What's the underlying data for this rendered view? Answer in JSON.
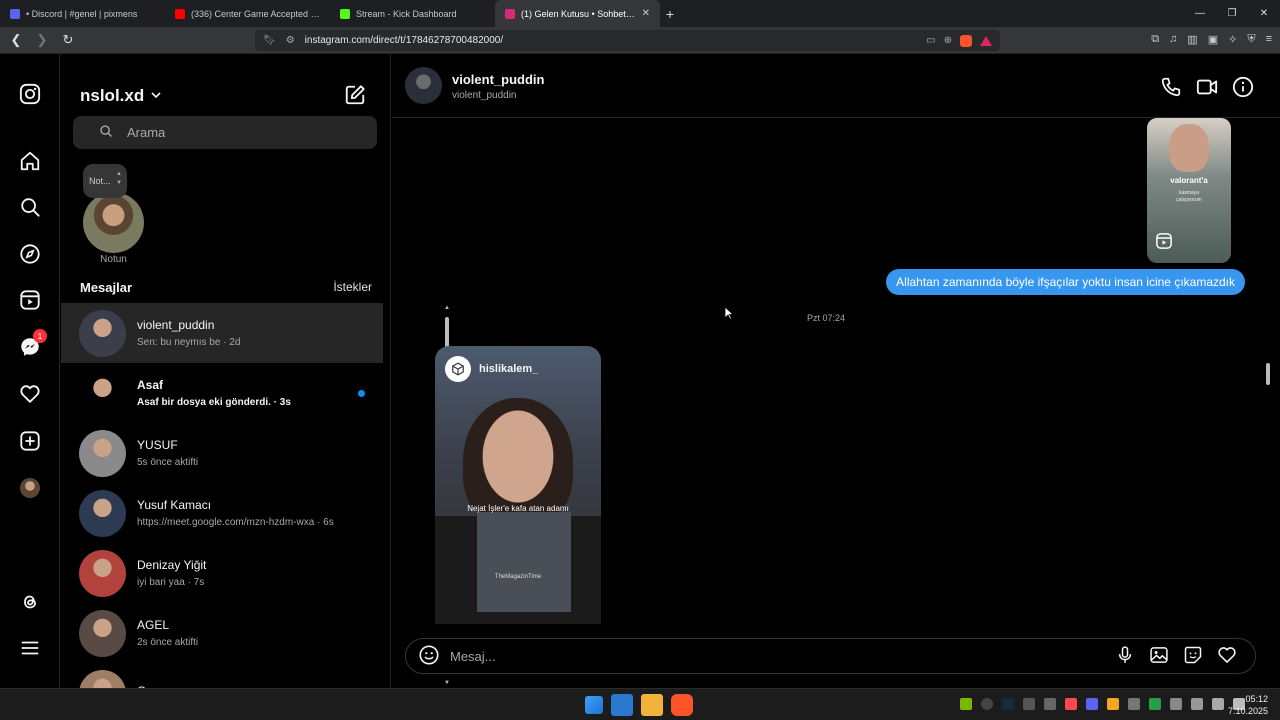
{
  "browser": {
    "tabs": [
      {
        "title": "• Discord | #genel | pixmens",
        "color": "#5865f2"
      },
      {
        "title": "(336) Center Game Accepted #Chess",
        "color": "#ff0000"
      },
      {
        "title": "Stream - Kick Dashboard",
        "color": "#53fc18"
      },
      {
        "title": "(1) Gelen Kutusu • Sohbetler",
        "color": "#d62976",
        "active": true
      }
    ],
    "url": "instagram.com/direct/t/17846278700482000/"
  },
  "inbox": {
    "account": "nslol.xd",
    "search_placeholder": "Arama",
    "note_text": "Not...",
    "note_label": "Notun",
    "messages_label": "Mesajlar",
    "requests_label": "İstekler",
    "conversations": [
      {
        "name": "violent_puddin",
        "sub": "Sen: bu neymıs be · 2d",
        "selected": true,
        "avatar": "#3a3f4b"
      },
      {
        "name": "Asaf",
        "sub": "Asaf bir dosya eki gönderdi. · 3s",
        "unread": true,
        "avatar": "#000000"
      },
      {
        "name": "YUSUF",
        "sub": "5s önce aktifti",
        "avatar": "#8a8a8a"
      },
      {
        "name": "Yusuf Kamacı",
        "sub": "https://meet.google.com/mzn-hzdm-wxa · 6s",
        "avatar": "#2c3a52"
      },
      {
        "name": "Denizay Yiğit",
        "sub": "iyi bari yaa · 7s",
        "avatar": "#b2423c"
      },
      {
        "name": "AGEL",
        "sub": "2s önce aktifti",
        "avatar": "#5a4a45"
      },
      {
        "name": "Ceren",
        "sub": "",
        "avatar": "#a07e66"
      }
    ]
  },
  "chat": {
    "name": "violent_puddin",
    "username": "violent_puddin",
    "reel_caption": "valorant'a",
    "reel_sub": "kasmaya\nçalışıyorum",
    "message": "Allahtan zamanında böyle ifşaçılar yoktu insan icine çıkamazdık",
    "timestamp": "Pzt 07:24",
    "shared_user": "hislikalem_",
    "shared_caption": "Nejat İşler'e kafa atan adamı",
    "shared_watermark": "TheMagazinTime",
    "composer_placeholder": "Mesaj..."
  },
  "rail": {
    "notification_count": "1"
  },
  "taskbar": {
    "time": "05:12",
    "date": "7.10.2025"
  }
}
